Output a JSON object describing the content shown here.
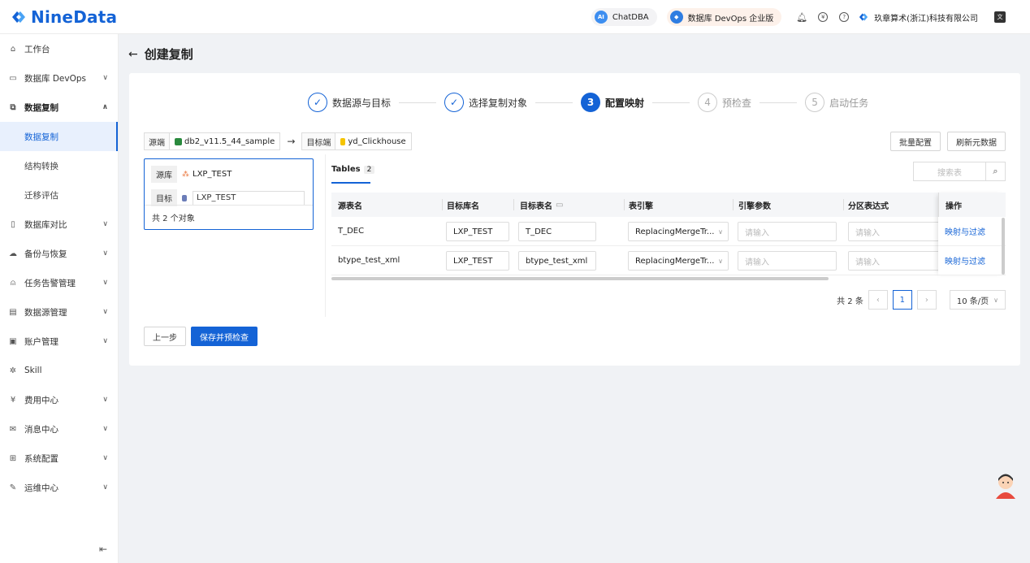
{
  "brand": {
    "name": "NineData",
    "accent": "#1463d6"
  },
  "header": {
    "chatdba": "ChatDBA",
    "edition": "数据库 DevOps 企业版",
    "company": "玖章算术(浙江)科技有限公司",
    "icons": [
      "bell-icon",
      "yen-icon",
      "help-icon",
      "translate-icon"
    ]
  },
  "sidebar": {
    "items": [
      {
        "label": "工作台",
        "icon": "home-icon"
      },
      {
        "label": "数据库 DevOps",
        "icon": "monitor-icon"
      },
      {
        "label": "数据复制",
        "icon": "copy-icon"
      },
      {
        "label": "数据库对比",
        "icon": "compare-icon"
      },
      {
        "label": "备份与恢复",
        "icon": "backup-icon"
      },
      {
        "label": "任务告警管理",
        "icon": "alarm-icon"
      },
      {
        "label": "数据源管理",
        "icon": "datasource-icon"
      },
      {
        "label": "账户管理",
        "icon": "account-icon"
      },
      {
        "label": "Skill",
        "icon": "skill-icon"
      },
      {
        "label": "费用中心",
        "icon": "fee-icon"
      },
      {
        "label": "消息中心",
        "icon": "mail-icon"
      },
      {
        "label": "系统配置",
        "icon": "grid-icon"
      },
      {
        "label": "运维中心",
        "icon": "wrench-icon"
      }
    ],
    "sub": [
      "数据复制",
      "结构转换",
      "迁移评估"
    ]
  },
  "page": {
    "title": "创建复制"
  },
  "steps": [
    "数据源与目标",
    "选择复制对象",
    "配置映射",
    "预检查",
    "启动任务"
  ],
  "step_numbers": [
    "3",
    "4",
    "5"
  ],
  "connection": {
    "source_label": "源端",
    "source": "db2_v11.5_44_sample",
    "target_label": "目标端",
    "target": "yd_Clickhouse"
  },
  "actions": {
    "batch": "批量配置",
    "refresh": "刷新元数据"
  },
  "panel": {
    "src_tag": "源库",
    "src_db": "LXP_TEST",
    "tgt_tag": "目标",
    "tgt_db": "LXP_TEST",
    "total": "共 2 个对象"
  },
  "tabs": {
    "label": "Tables",
    "count": "2"
  },
  "search": {
    "placeholder": "搜索表"
  },
  "table": {
    "headers": [
      "源表名",
      "目标库名",
      "目标表名",
      "表引擎",
      "引擎参数",
      "分区表达式",
      "操作"
    ],
    "placeholder": "请输入",
    "rows": [
      {
        "src": "T_DEC",
        "db": "LXP_TEST",
        "tbl": "T_DEC",
        "engine": "ReplacingMergeTr...",
        "op": "映射与过滤"
      },
      {
        "src": "btype_test_xml",
        "db": "LXP_TEST",
        "tbl": "btype_test_xml",
        "engine": "ReplacingMergeTr...",
        "op": "映射与过滤"
      }
    ]
  },
  "pager": {
    "total": "共 2 条",
    "page": "1",
    "size": "10 条/页"
  },
  "footer": {
    "prev": "上一步",
    "save": "保存并预检查"
  }
}
